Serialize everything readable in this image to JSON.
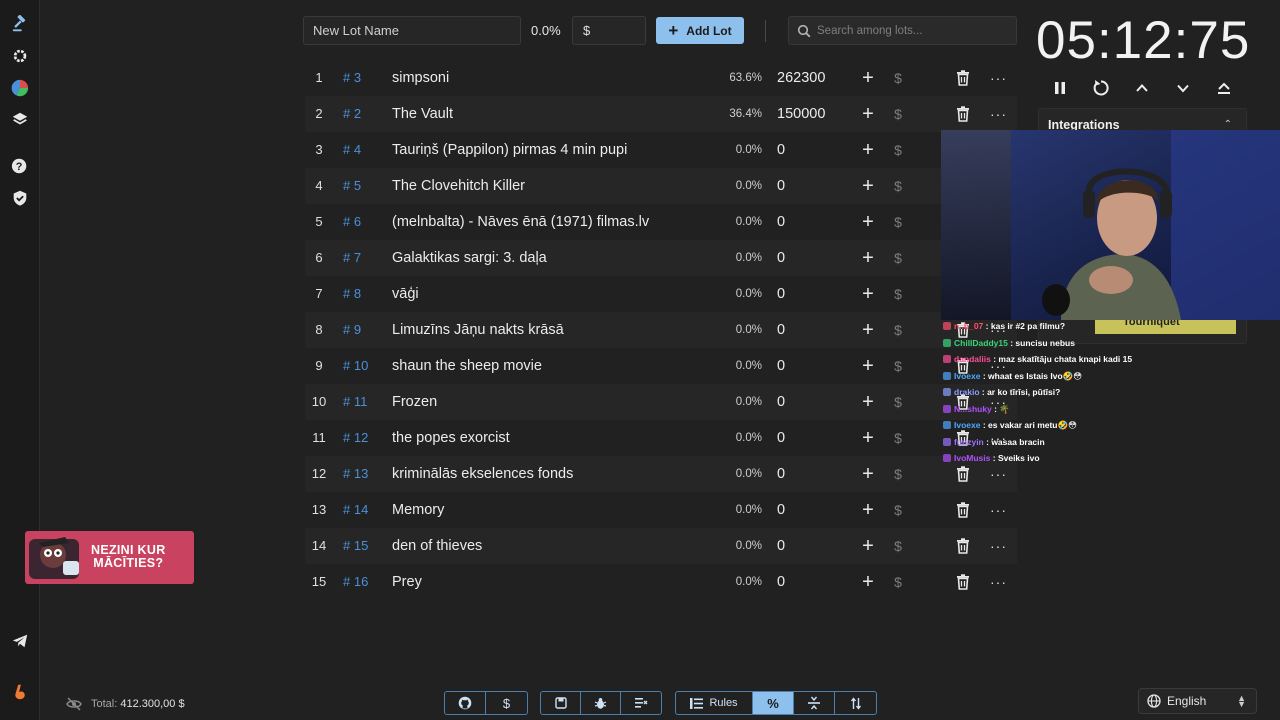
{
  "sidebar": {
    "icons": [
      "gavel-icon",
      "gear-icon",
      "pie-chart-icon",
      "layers-icon",
      "help-icon",
      "shield-icon",
      "telegram-icon",
      "boosty-icon"
    ]
  },
  "topbar": {
    "lot_name_placeholder": "New Lot Name",
    "percent": "0.0%",
    "amount_placeholder": "$",
    "add_lot_label": "Add Lot",
    "search_placeholder": "Search among lots..."
  },
  "lots": [
    {
      "idx": "1",
      "id": "# 3",
      "name": "simpsoni",
      "pct": "63.6%",
      "amount": "262300"
    },
    {
      "idx": "2",
      "id": "# 2",
      "name": "The Vault",
      "pct": "36.4%",
      "amount": "150000"
    },
    {
      "idx": "3",
      "id": "# 4",
      "name": "Tauriņš (Pappilon) pirmas 4 min pupi",
      "pct": "0.0%",
      "amount": "0"
    },
    {
      "idx": "4",
      "id": "# 5",
      "name": "The Clovehitch Killer",
      "pct": "0.0%",
      "amount": "0"
    },
    {
      "idx": "5",
      "id": "# 6",
      "name": "(melnbalta) - Nāves ēnā (1971) filmas.lv",
      "pct": "0.0%",
      "amount": "0"
    },
    {
      "idx": "6",
      "id": "# 7",
      "name": "Galaktikas sargi: 3. daļa",
      "pct": "0.0%",
      "amount": "0"
    },
    {
      "idx": "7",
      "id": "# 8",
      "name": "vāģi",
      "pct": "0.0%",
      "amount": "0"
    },
    {
      "idx": "8",
      "id": "# 9",
      "name": "Limuzīns Jāņu nakts krāsā",
      "pct": "0.0%",
      "amount": "0"
    },
    {
      "idx": "9",
      "id": "# 10",
      "name": "shaun the sheep movie",
      "pct": "0.0%",
      "amount": "0"
    },
    {
      "idx": "10",
      "id": "# 11",
      "name": "Frozen",
      "pct": "0.0%",
      "amount": "0"
    },
    {
      "idx": "11",
      "id": "# 12",
      "name": "the popes exorcist",
      "pct": "0.0%",
      "amount": "0"
    },
    {
      "idx": "12",
      "id": "# 13",
      "name": "kriminālās ekselences fonds",
      "pct": "0.0%",
      "amount": "0"
    },
    {
      "idx": "13",
      "id": "# 14",
      "name": "Memory",
      "pct": "0.0%",
      "amount": "0"
    },
    {
      "idx": "14",
      "id": "# 15",
      "name": "den of thieves",
      "pct": "0.0%",
      "amount": "0"
    },
    {
      "idx": "15",
      "id": "# 16",
      "name": "Prey",
      "pct": "0.0%",
      "amount": "0"
    }
  ],
  "lot_row_icons": {
    "plus": "+",
    "dollar": "$",
    "more": "···"
  },
  "timer": {
    "value": "05:12:75",
    "controls": [
      "pause-icon",
      "reset-icon",
      "chevron-up-icon",
      "chevron-down-icon",
      "eject-icon"
    ]
  },
  "integrations": {
    "title": "Integrations"
  },
  "overlay": {
    "banner_text": "Tourniquet",
    "chat": [
      {
        "user": "n..b_07",
        "user_color": "#ff4f6d",
        "text": ": kas ir #2 pa filmu?"
      },
      {
        "user": "ChillDaddy15",
        "user_color": "#37d67a",
        "text": ": suncisu nebus"
      },
      {
        "user": "dandaliis",
        "user_color": "#ff4f9a",
        "text": ": maz skatītāju chata knapi kadi 15"
      },
      {
        "user": "Ivoexe",
        "user_color": "#4fa8ff",
        "text": ": whaat es Istais Ivo🤣😳"
      },
      {
        "user": "drakio",
        "user_color": "#8aa0ff",
        "text": ": ar ko tīrīsi, pūtīsi?"
      },
      {
        "user": "N...shuky",
        "user_color": "#b04fff",
        "text": ": 🌴"
      },
      {
        "user": "Ivoexe",
        "user_color": "#4fa8ff",
        "text": ": es vakar ari metu🤣😳"
      },
      {
        "user": "funzyin",
        "user_color": "#a070ff",
        "text": ": wasaa bracin"
      },
      {
        "user": "IvoMusis",
        "user_color": "#b04fff",
        "text": ": Sveiks ivo"
      }
    ],
    "ad_text_line1": "NEZINI KUR",
    "ad_text_line2": "MĀCĪTIES?"
  },
  "footer": {
    "total_label": "Total:",
    "total_value": "412.300,00 $",
    "rules_label": "Rules",
    "language": "English"
  },
  "colors": {
    "accent": "#8ec0ee",
    "lot_id": "#4a90d9",
    "background": "#212121"
  }
}
